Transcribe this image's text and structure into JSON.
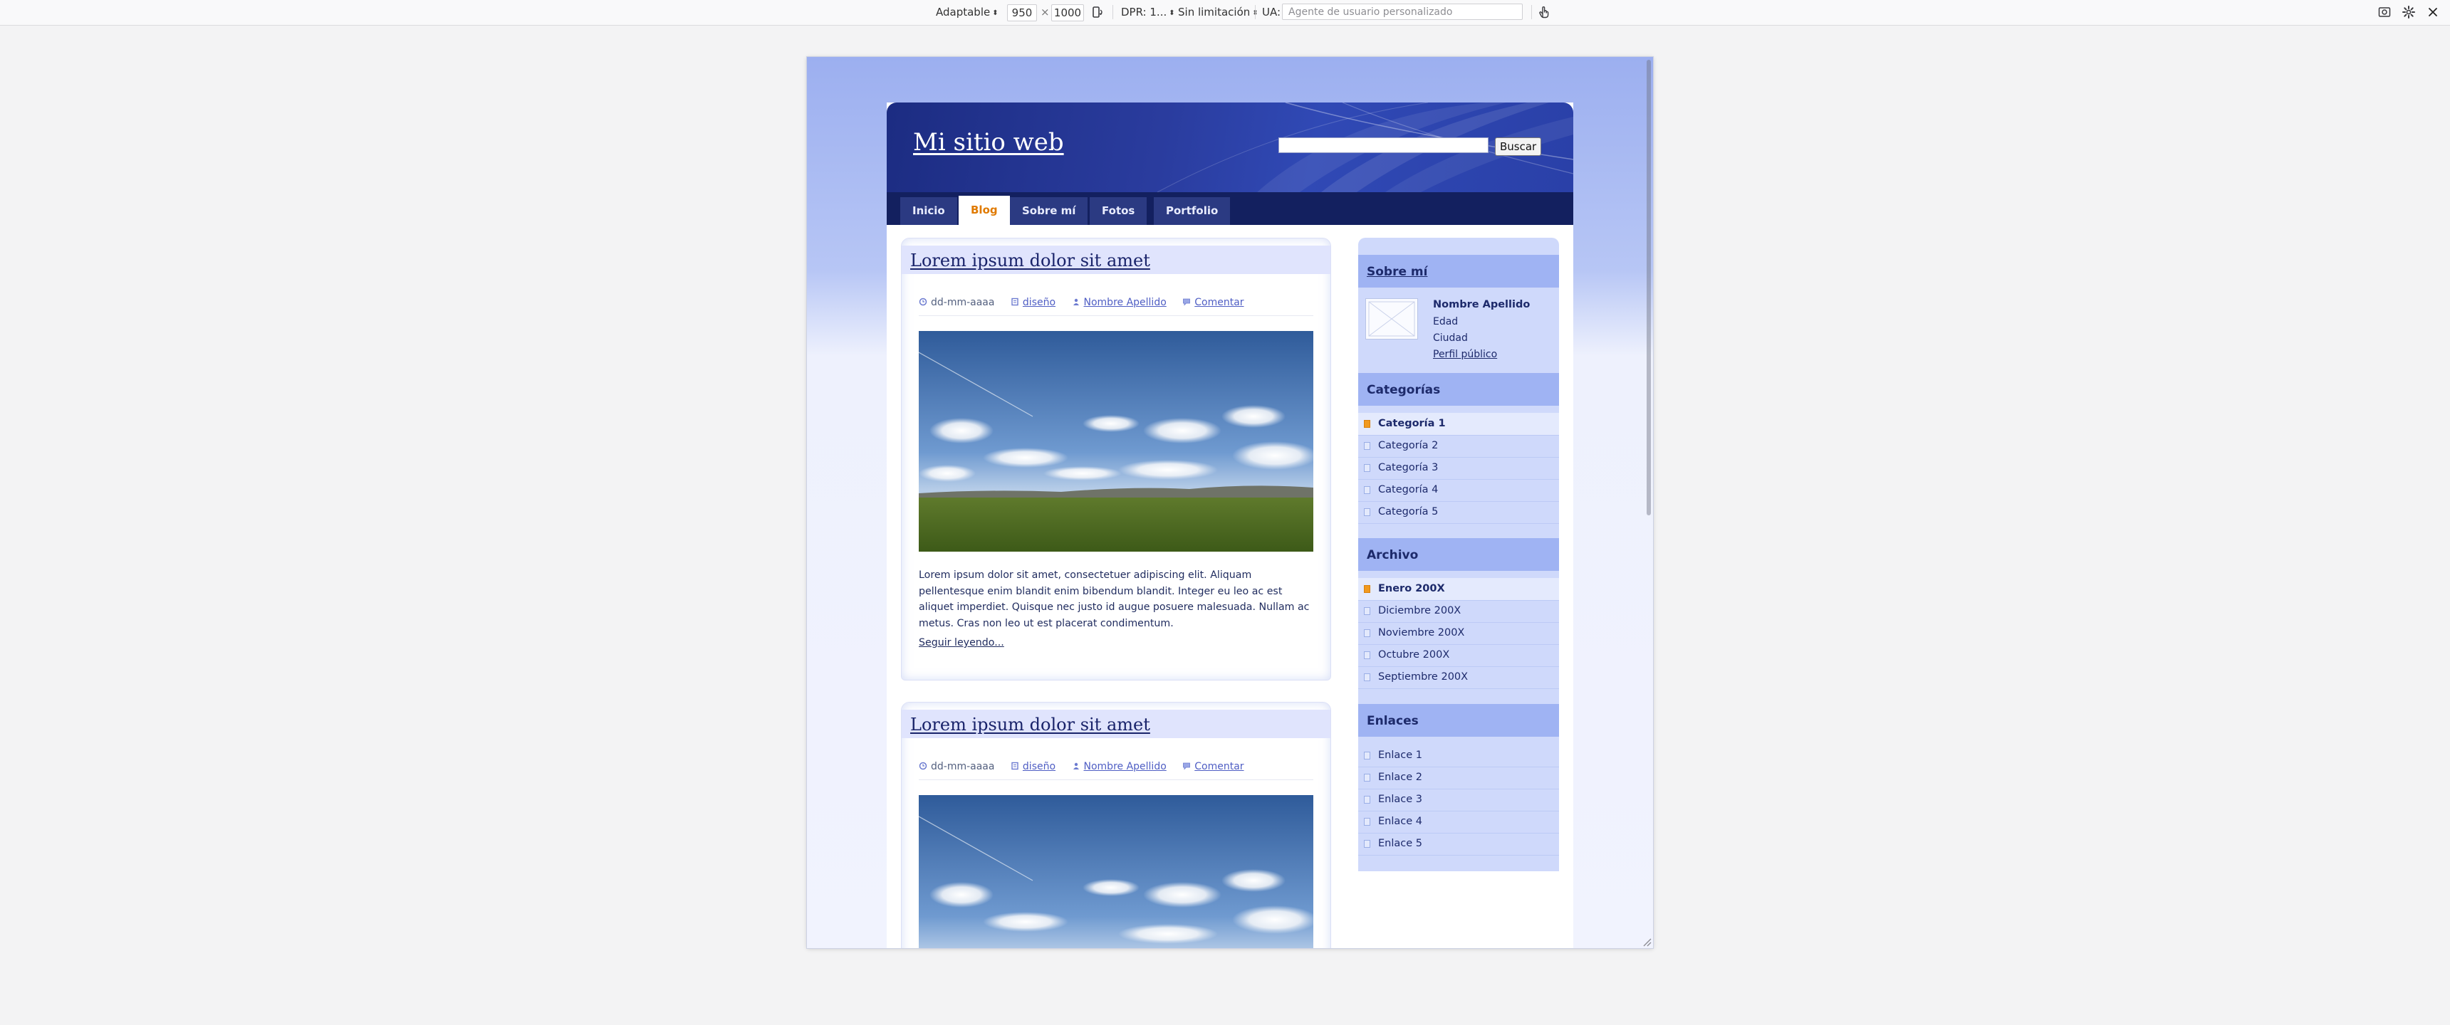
{
  "toolbar": {
    "device": "Adaptable",
    "width": "950",
    "times": "×",
    "height": "1000",
    "dpr": "DPR: 1...",
    "throttling": "Sin limitación",
    "ua_label": "UA:",
    "ua_placeholder": "Agente de usuario personalizado"
  },
  "site": {
    "title": "Mi sitio web",
    "search_button": "Buscar",
    "nav": [
      "Inicio",
      "Blog",
      "Sobre mí",
      "Fotos",
      "Portfolio"
    ],
    "nav_active": "Blog"
  },
  "posts": [
    {
      "title": "Lorem ipsum dolor sit amet",
      "date": "dd-mm-aaaa",
      "category": "diseño",
      "author": "Nombre Apellido",
      "comment": "Comentar",
      "body": "Lorem ipsum dolor sit amet, consectetuer adipiscing elit. Aliquam pellentesque enim blandit enim bibendum blandit. Integer eu leo ac est aliquet imperdiet. Quisque nec justo id augue posuere malesuada. Nullam ac metus. Cras non leo ut est placerat condimentum.",
      "read_more": "Seguir leyendo..."
    },
    {
      "title": "Lorem ipsum dolor sit amet",
      "date": "dd-mm-aaaa",
      "category": "diseño",
      "author": "Nombre Apellido",
      "comment": "Comentar"
    }
  ],
  "sidebar": {
    "about": {
      "heading": "Sobre mí",
      "name": "Nombre Apellido",
      "age": "Edad",
      "city": "Ciudad",
      "profile_link": "Perfil público"
    },
    "categories": {
      "heading": "Categorías",
      "items": [
        "Categoría 1",
        "Categoría 2",
        "Categoría 3",
        "Categoría 4",
        "Categoría 5"
      ]
    },
    "archive": {
      "heading": "Archivo",
      "items": [
        "Enero 200X",
        "Diciembre 200X",
        "Noviembre 200X",
        "Octubre 200X",
        "Septiembre 200X"
      ]
    },
    "links": {
      "heading": "Enlaces",
      "items": [
        "Enlace 1",
        "Enlace 2",
        "Enlace 3",
        "Enlace 4",
        "Enlace 5"
      ]
    }
  },
  "colors": {
    "accent_active_tab": "#e07a00",
    "header_blue": "#2a3c9e",
    "sidebar_bg": "#cfd9fb"
  }
}
